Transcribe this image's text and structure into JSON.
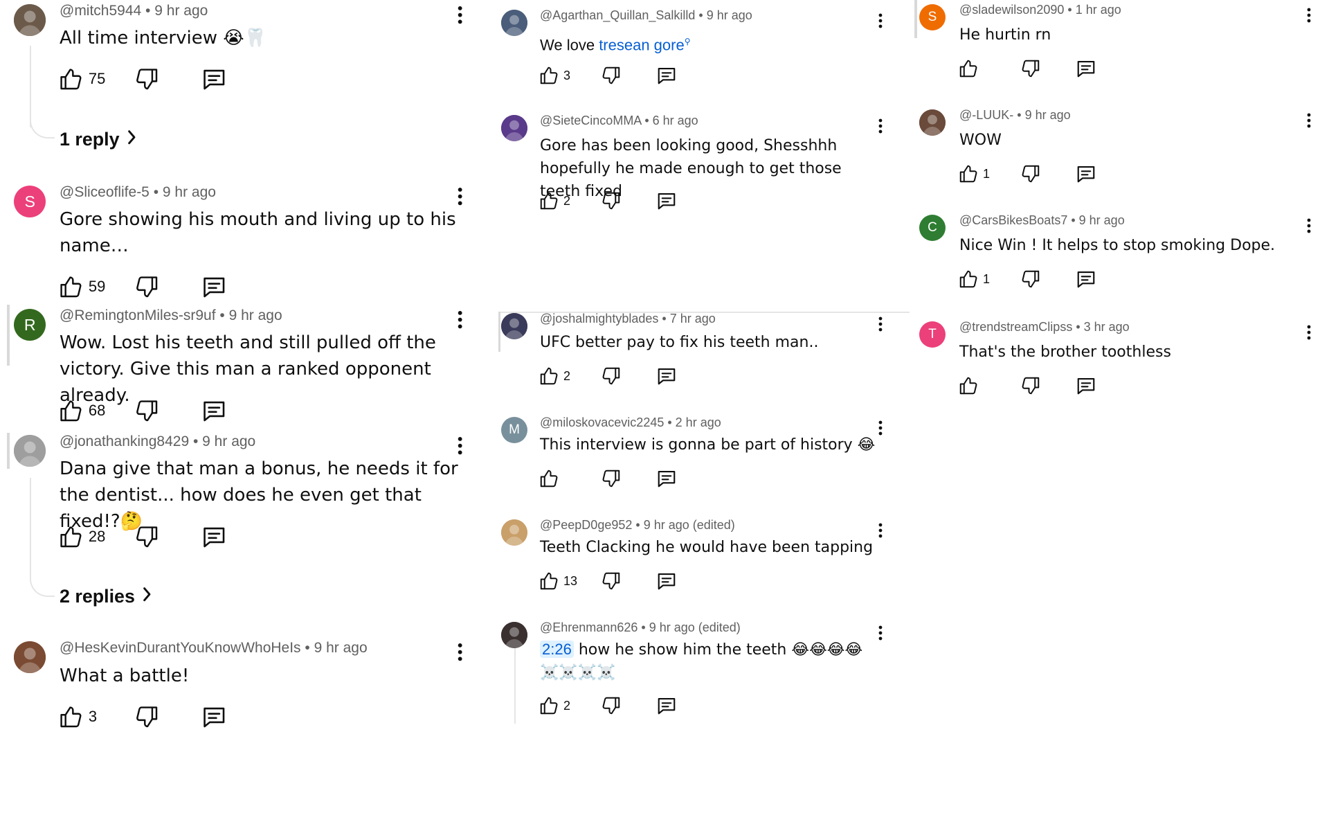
{
  "colors": {
    "text_primary": "#0f0f0f",
    "text_secondary": "#606060",
    "link": "#065fd4",
    "timestamp_bg": "#def1ff",
    "thread_line": "#e5e5e5"
  },
  "icons": {
    "like": "thumbs-up-icon",
    "dislike": "thumbs-down-icon",
    "reply": "comment-reply-icon",
    "more": "more-vert-icon",
    "chevron": "chevron-right-icon"
  },
  "column1": [
    {
      "author": "@mitch5944",
      "time": "9 hr ago",
      "text": "All time interview 😭🦷",
      "likes": "75",
      "replies_label": "1 reply",
      "avatar": {
        "kind": "photo",
        "color": "#6b5a4a"
      }
    },
    {
      "author": "@Sliceoflife-5",
      "time": "9 hr ago",
      "text": "Gore showing his mouth and living up to his name…",
      "likes": "59",
      "avatar": {
        "kind": "letter",
        "letter": "S",
        "color": "#ec407a"
      }
    },
    {
      "author": "@RemingtonMiles-sr9uf",
      "time": "9 hr ago",
      "text": "Wow. Lost his teeth and still pulled off the victory. Give this man a ranked opponent already.",
      "likes": "68",
      "avatar": {
        "kind": "letter",
        "letter": "R",
        "color": "#33691e"
      }
    },
    {
      "author": "@jonathanking8429",
      "time": "9 hr ago",
      "text": "Dana give that man a bonus, he needs it for the dentist... how does he even get that fixed!?🤔",
      "likes": "28",
      "replies_label": "2 replies",
      "avatar": {
        "kind": "photo",
        "color": "#9e9e9e"
      }
    },
    {
      "author": "@HesKevinDurantYouKnowWhoHeIs",
      "time": "9 hr ago",
      "text": "What a battle!",
      "likes": "3",
      "avatar": {
        "kind": "photo",
        "color": "#7a4a32"
      }
    }
  ],
  "column2": [
    {
      "author": "@Agarthan_Quillan_Salkilld",
      "time": "9 hr ago",
      "text_prefix": "We love ",
      "link_text": "tresean gore",
      "likes": "3",
      "avatar": {
        "kind": "photo",
        "color": "#4a5d7a"
      }
    },
    {
      "author": "@SieteCincoMMA",
      "time": "6 hr ago",
      "text": "Gore has been looking good, Shesshhh hopefully he made enough to get those teeth fixed",
      "likes": "2",
      "avatar": {
        "kind": "photo",
        "color": "#5a3a8a"
      }
    },
    {
      "author": "@joshalmightyblades",
      "time": "7 hr ago",
      "text": "UFC better pay to fix his teeth man..",
      "likes": "2",
      "avatar": {
        "kind": "photo",
        "color": "#3a3a5a"
      }
    },
    {
      "author": "@miloskovacevic2245",
      "time": "2 hr ago",
      "text": "This interview is gonna be part of history 😂",
      "likes": "",
      "avatar": {
        "kind": "letter",
        "letter": "M",
        "color": "#78909c"
      }
    },
    {
      "author": "@PeepD0ge952",
      "time": "9 hr ago (edited)",
      "text": "Teeth Clacking he would have been tapping",
      "likes": "13",
      "avatar": {
        "kind": "photo",
        "color": "#c9a06a"
      }
    },
    {
      "author": "@Ehrenmann626",
      "time": "9 hr ago (edited)",
      "timestamp": "2:26",
      "text": " how he show him the teeth 😂😂😂😂 ☠️☠️☠️☠️",
      "likes": "2",
      "avatar": {
        "kind": "photo",
        "color": "#3a3030"
      }
    }
  ],
  "column3": [
    {
      "author": "@sladewilson2090",
      "time": "1 hr ago",
      "text": "He hurtin rn",
      "likes": "",
      "avatar": {
        "kind": "letter",
        "letter": "S",
        "color": "#ef6c00"
      }
    },
    {
      "author": "@-LUUK-",
      "time": "9 hr ago",
      "text": "WOW",
      "likes": "1",
      "avatar": {
        "kind": "photo",
        "color": "#6a4a3a"
      }
    },
    {
      "author": "@CarsBikesBoats7",
      "time": "9 hr ago",
      "text": "Nice Win ! It helps to stop smoking Dope.",
      "likes": "1",
      "avatar": {
        "kind": "letter",
        "letter": "C",
        "color": "#2e7d32"
      }
    },
    {
      "author": "@trendstreamClipss",
      "time": "3 hr ago",
      "text": "That's the brother toothless",
      "likes": "",
      "avatar": {
        "kind": "letter",
        "letter": "T",
        "color": "#ec407a"
      }
    }
  ]
}
